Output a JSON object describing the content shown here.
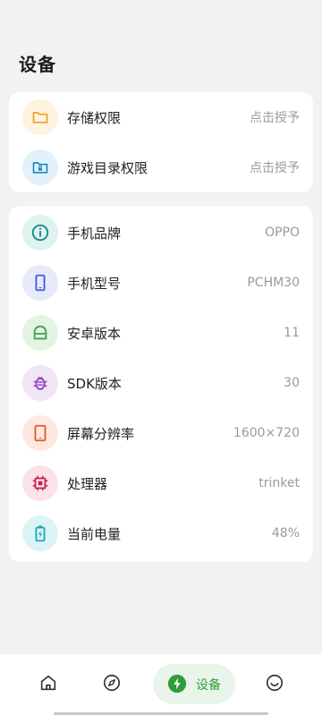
{
  "page": {
    "title": "设备"
  },
  "permissions": [
    {
      "label": "存储权限",
      "value": "点击授予",
      "icon": "folder-icon",
      "color": "#f0a020",
      "bg": "#fdf3df"
    },
    {
      "label": "游戏目录权限",
      "value": "点击授予",
      "icon": "folder-lock-icon",
      "color": "#1e88c8",
      "bg": "#e3f1fb"
    }
  ],
  "device_info": [
    {
      "label": "手机品牌",
      "value": "OPPO",
      "icon": "info-icon",
      "color": "#148a8a",
      "bg": "#def2f0"
    },
    {
      "label": "手机型号",
      "value": "PCHM30",
      "icon": "phone-icon",
      "color": "#3f5bd8",
      "bg": "#e6eafb"
    },
    {
      "label": "安卓版本",
      "value": "11",
      "icon": "android-icon",
      "color": "#3ba64a",
      "bg": "#e4f4e4"
    },
    {
      "label": "SDK版本",
      "value": "30",
      "icon": "bug-icon",
      "color": "#8e3fb8",
      "bg": "#f1e5f8"
    },
    {
      "label": "屏幕分辨率",
      "value": "1600×720",
      "icon": "tablet-icon",
      "color": "#e05a24",
      "bg": "#fde9df"
    },
    {
      "label": "处理器",
      "value": "trinket",
      "icon": "chip-icon",
      "color": "#c8204a",
      "bg": "#fbe2e9"
    },
    {
      "label": "当前电量",
      "value": "48%",
      "icon": "battery-icon",
      "color": "#1aa8b8",
      "bg": "#ddf4f6"
    }
  ],
  "bottom_nav": {
    "items": [
      {
        "icon": "home-icon"
      },
      {
        "icon": "compass-icon"
      },
      {
        "icon": "bolt-icon",
        "label": "设备",
        "active": true
      },
      {
        "icon": "smile-icon"
      }
    ],
    "active_color": "#2e9d3a"
  }
}
